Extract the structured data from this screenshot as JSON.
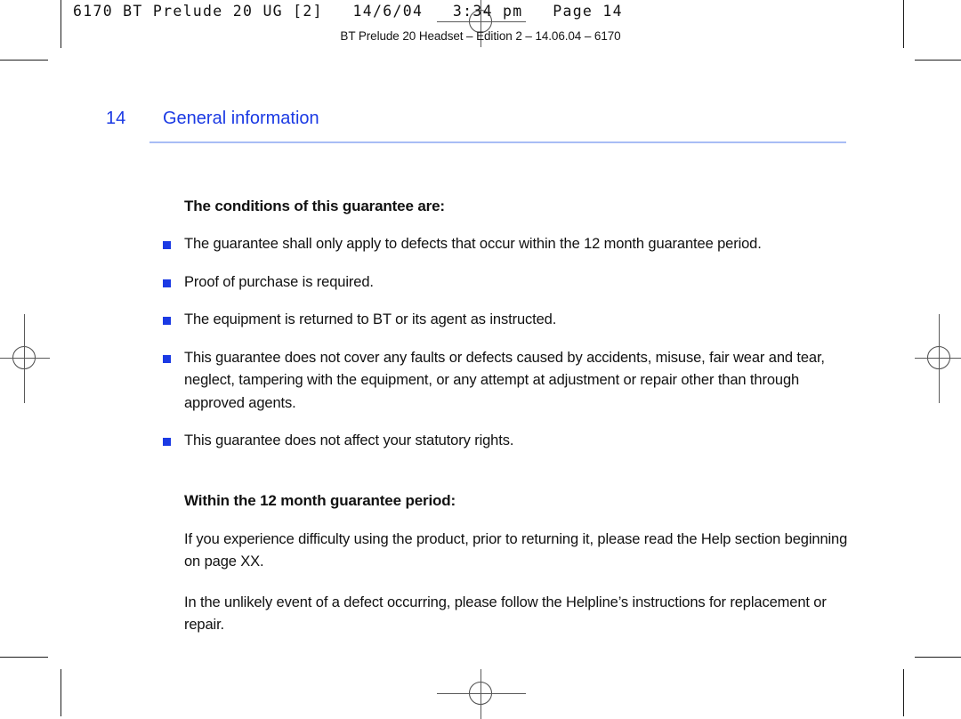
{
  "print_marks": {
    "slug_text": "6170 BT Prelude 20 UG [2]   14/6/04   3:34 pm   Page 14",
    "running_footer": "BT Prelude 20 Headset – Edition 2 – 14.06.04 – 6170"
  },
  "page": {
    "number": "14",
    "chapter_title": "General information",
    "accent_color": "#1b3ae4",
    "rule_color": "#a8bdf5",
    "sections": [
      {
        "heading": "The conditions of this guarantee are:",
        "bullets": [
          "The guarantee shall only apply to defects that occur within the 12 month guarantee period.",
          "Proof of purchase is required.",
          "The equipment is returned to BT or its agent as instructed.",
          "This guarantee does not cover any faults or defects caused by accidents, misuse, fair wear and tear, neglect, tampering with the equipment, or any attempt at adjustment or repair other than through approved agents.",
          "This guarantee does not affect your statutory rights."
        ]
      },
      {
        "heading": "Within the 12 month guarantee period:",
        "paragraphs": [
          "If you experience difficulty using the product, prior to returning it, please read the Help section beginning on page XX.",
          "In the unlikely event of a defect occurring, please follow the Helpline’s instructions for replacement or repair."
        ]
      }
    ]
  }
}
